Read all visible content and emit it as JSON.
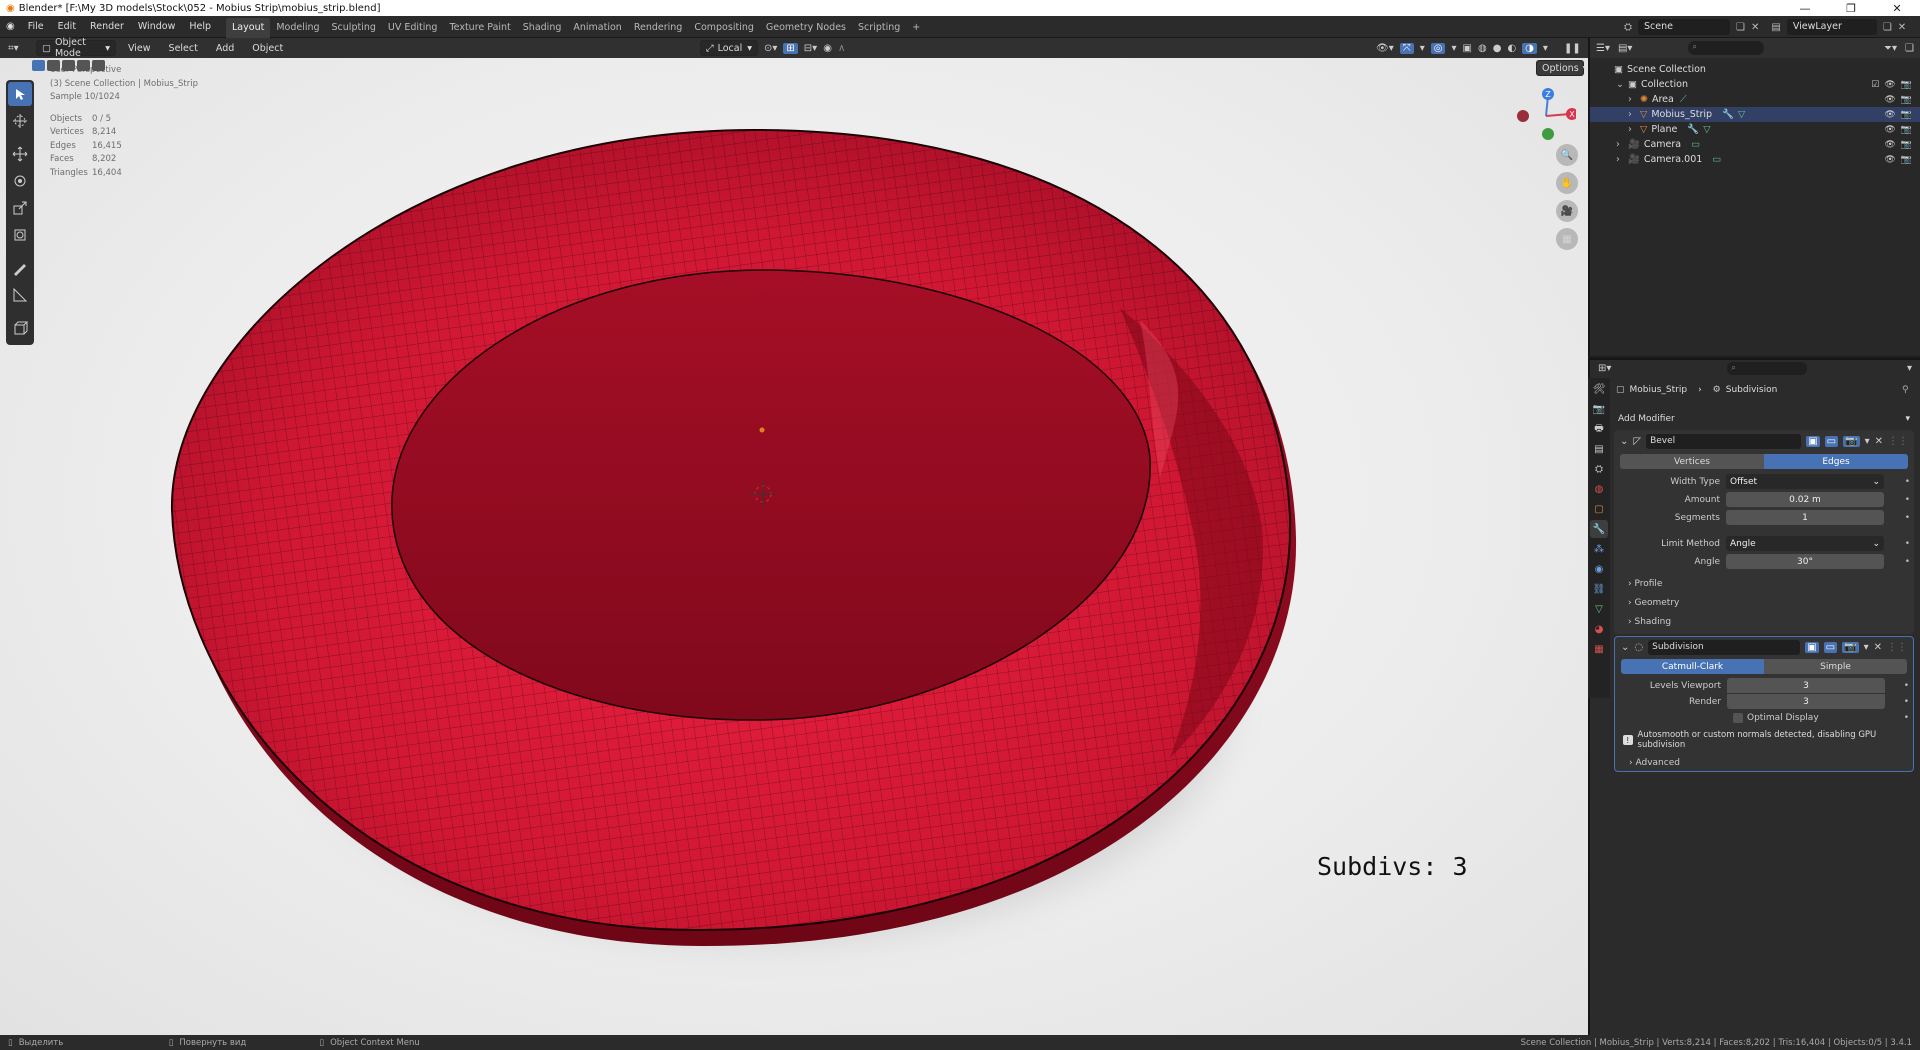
{
  "window": {
    "title": "Blender* [F:\\My 3D models\\Stock\\052 - Mobius Strip\\mobius_strip.blend]",
    "controls": [
      "—",
      "❐",
      "✕"
    ]
  },
  "menu": [
    "File",
    "Edit",
    "Render",
    "Window",
    "Help"
  ],
  "workspaces": [
    "Layout",
    "Modeling",
    "Sculpting",
    "UV Editing",
    "Texture Paint",
    "Shading",
    "Animation",
    "Rendering",
    "Compositing",
    "Geometry Nodes",
    "Scripting",
    "+"
  ],
  "active_workspace": "Layout",
  "scene": {
    "name": "Scene",
    "view_layer": "ViewLayer"
  },
  "viewport_header": {
    "mode": "Object Mode",
    "menus": [
      "View",
      "Select",
      "Add",
      "Object"
    ],
    "orientation": "Local",
    "options": "Options"
  },
  "overlay": {
    "view": "User Perspective",
    "collection": "(3) Scene Collection | Mobius_Strip",
    "sample": "Sample 10/1024",
    "stats": [
      {
        "label": "Objects",
        "value": "0 / 5"
      },
      {
        "label": "Vertices",
        "value": "8,214"
      },
      {
        "label": "Edges",
        "value": "16,415"
      },
      {
        "label": "Faces",
        "value": "8,202"
      },
      {
        "label": "Triangles",
        "value": "16,404"
      }
    ]
  },
  "gizmo": {
    "z": "Z",
    "x": "X"
  },
  "caption": "Subdivs: 3",
  "outliner": {
    "root": "Scene Collection",
    "items": [
      {
        "name": "Collection",
        "level": 1
      },
      {
        "name": "Area",
        "level": 2
      },
      {
        "name": "Mobius_Strip",
        "level": 2
      },
      {
        "name": "Plane",
        "level": 2
      },
      {
        "name": "Camera",
        "level": 1
      },
      {
        "name": "Camera.001",
        "level": 1
      }
    ]
  },
  "properties": {
    "breadcrumb_object": "Mobius_Strip",
    "breadcrumb_modifier": "Subdivision",
    "add_modifier": "Add Modifier",
    "bevel": {
      "name": "Bevel",
      "affect": [
        "Vertices",
        "Edges"
      ],
      "affect_active": "Edges",
      "width_type_label": "Width Type",
      "width_type": "Offset",
      "amount_label": "Amount",
      "amount": "0.02 m",
      "segments_label": "Segments",
      "segments": "1",
      "limit_method_label": "Limit Method",
      "limit_method": "Angle",
      "angle_label": "Angle",
      "angle": "30°",
      "subpanels": [
        "Profile",
        "Geometry",
        "Shading"
      ]
    },
    "subdivision": {
      "name": "Subdivision",
      "types": [
        "Catmull-Clark",
        "Simple"
      ],
      "type_active": "Catmull-Clark",
      "levels_viewport_label": "Levels Viewport",
      "levels_viewport": "3",
      "render_label": "Render",
      "render": "3",
      "optimal_display": "Optimal Display",
      "warning": "Autosmooth or custom normals detected, disabling GPU subdivision",
      "advanced": "Advanced"
    }
  },
  "statusbar": {
    "left": [
      "Выделить",
      "Повернуть вид",
      "Object Context Menu"
    ],
    "right": "Scene Collection | Mobius_Strip | Verts:8,214 | Faces:8,202 | Tris:16,404 | Objects:0/5 | 3.4.1"
  },
  "colors": {
    "strip": "#d81b35",
    "accent": "#4772b3",
    "viewport_bg": "#ececec"
  }
}
